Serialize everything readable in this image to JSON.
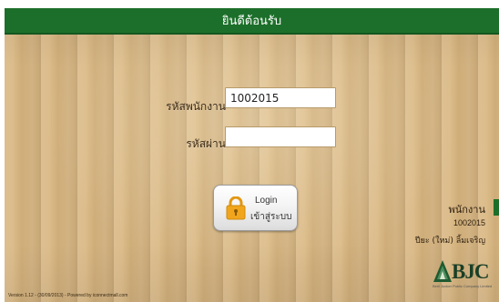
{
  "header": {
    "title": "ยินดีต้อนรับ"
  },
  "form": {
    "employee_id_label": "รหัสพนักงาน",
    "employee_id_value": "1002015",
    "password_label": "รหัสผ่าน",
    "password_value": ""
  },
  "login_button": {
    "label_en": "Login",
    "label_th": "เข้าสู่ระบบ"
  },
  "employee_info": {
    "title": "พนักงาน",
    "id": "1002015",
    "name": "ปียะ (ใหม่) ลิ้มเจริญ"
  },
  "logo": {
    "text": "BJC",
    "subtitle": "Berli Jucker Public Company Limited"
  },
  "footer": {
    "version": "Version 1.12 - (30/09/2013) - Powered by iconnectmall.com"
  },
  "colors": {
    "header": "#1c6f2a",
    "wood": "#d8b783",
    "lock": "#f0a51c"
  },
  "icons": {
    "lock": "lock-icon",
    "logo_mark": "bjc-mountain-icon"
  }
}
